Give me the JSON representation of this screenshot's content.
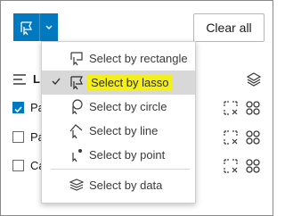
{
  "toolbar": {
    "select_tool_icon": "select-lasso-icon",
    "dropdown_icon": "chevron-down-icon",
    "clear_all_label": "Clear all"
  },
  "list": {
    "header_label": "L",
    "rows": [
      {
        "label": "Pa",
        "checked": true
      },
      {
        "label": "Pa",
        "checked": false
      },
      {
        "label": "Ca",
        "checked": false
      }
    ]
  },
  "menu": {
    "items": [
      {
        "label": "Select by rectangle",
        "icon": "select-rectangle-icon",
        "selected": false
      },
      {
        "label": "Select by lasso",
        "icon": "select-lasso-icon",
        "selected": true
      },
      {
        "label": "Select by circle",
        "icon": "select-circle-icon",
        "selected": false
      },
      {
        "label": "Select by line",
        "icon": "select-line-icon",
        "selected": false
      },
      {
        "label": "Select by point",
        "icon": "select-point-icon",
        "selected": false
      },
      {
        "label": "Select by data",
        "icon": "select-data-icon",
        "selected": false
      }
    ]
  },
  "colors": {
    "accent": "#0079c1",
    "highlight": "#f4ef1a",
    "selected_row": "#d8d8d8"
  }
}
